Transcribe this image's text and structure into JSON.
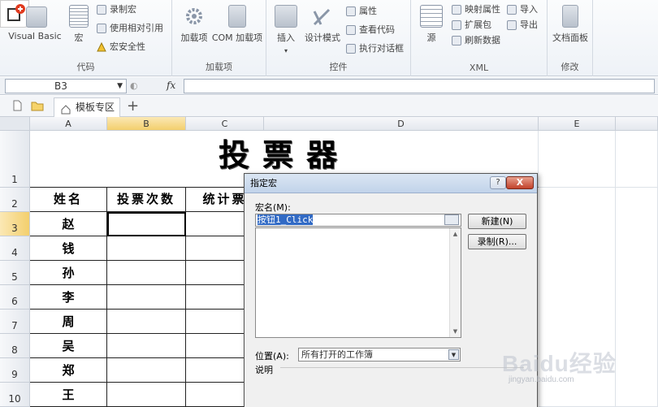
{
  "ribbon": {
    "code_group": {
      "label": "代码",
      "visual_basic": "Visual Basic",
      "macros": "宏",
      "record_macro": "录制宏",
      "relative_ref": "使用相对引用",
      "macro_security": "宏安全性"
    },
    "addins_group": {
      "label": "加载项",
      "addins": "加载项",
      "com_addins": "COM 加载项"
    },
    "controls_group": {
      "label": "控件",
      "insert": "插入",
      "design_mode": "设计模式",
      "properties": "属性",
      "view_code": "查看代码",
      "run_dialog": "执行对话框"
    },
    "xml_group": {
      "label": "XML",
      "source": "源",
      "map_properties": "映射属性",
      "expansion_packs": "扩展包",
      "refresh_data": "刷新数据",
      "import": "导入",
      "export": "导出"
    },
    "modify_group": {
      "label": "修改",
      "document_panel": "文档面板"
    }
  },
  "formula_bar": {
    "name_box": "B3",
    "fx": "fx"
  },
  "tabs": {
    "active": "模板专区",
    "add": "+"
  },
  "sheet": {
    "columns": [
      "A",
      "B",
      "C",
      "D",
      "E"
    ],
    "rows": [
      "1",
      "2",
      "3",
      "4",
      "5",
      "6",
      "7",
      "8",
      "9",
      "10"
    ],
    "title": "投票器",
    "headers": [
      "姓名",
      "投票次数",
      "统计票"
    ],
    "names": [
      "赵",
      "钱",
      "孙",
      "李",
      "周",
      "吴",
      "郑",
      "王"
    ]
  },
  "dialog": {
    "title": "指定宏",
    "help": "?",
    "close": "X",
    "macro_name_label": "宏名(M):",
    "macro_name_value": "按钮1_Click",
    "new_button": "新建(N)",
    "record_button": "录制(R)...",
    "location_label": "位置(A):",
    "location_value": "所有打开的工作簿",
    "description_label": "说明"
  },
  "watermark": {
    "brand": "Baidu经验",
    "url": "jingyan.baidu.com"
  }
}
